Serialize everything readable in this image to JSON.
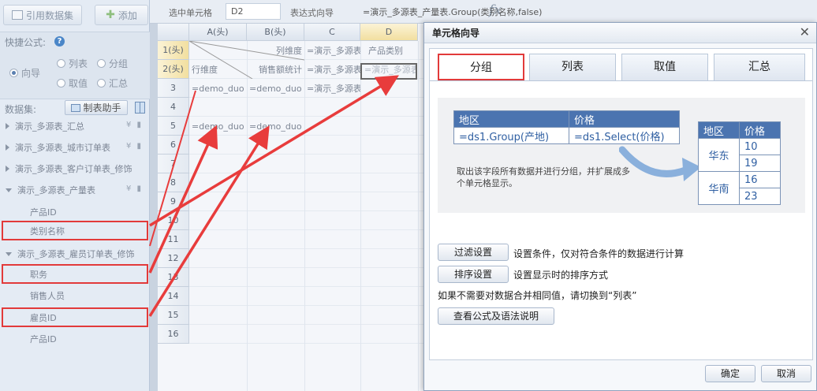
{
  "toolbar": {
    "ref_dataset": "引用数据集",
    "add": "添加"
  },
  "quick_formula": {
    "label": "快捷公式:",
    "options": {
      "guide": "向导",
      "list": "列表",
      "group": "分组",
      "value": "取值",
      "sum": "汇总"
    },
    "selected": "guide"
  },
  "dataset": {
    "label": "数据集:",
    "assist_button": "制表助手",
    "tree": [
      {
        "label": "演示_多源表_汇总",
        "expanded": false
      },
      {
        "label": "演示_多源表_城市订单表",
        "expanded": false
      },
      {
        "label": "演示_多源表_客户订单表_修饰",
        "expanded": false
      },
      {
        "label": "演示_多源表_产量表",
        "expanded": true,
        "fields": [
          "产品ID",
          "类别名称"
        ]
      },
      {
        "label": "演示_多源表_雇员订单表_修饰",
        "expanded": true,
        "fields": [
          "职务",
          "销售人员",
          "雇员ID",
          "产品ID"
        ]
      }
    ]
  },
  "formula_bar": {
    "selected_cell_label": "选中单元格",
    "selected_cell": "D2",
    "expr_guide_label": "表达式向导",
    "expression": "=演示_多源表_产量表.Group(类别名称,false)"
  },
  "grid": {
    "columns": [
      "A(头)",
      "B(头)",
      "C",
      "D"
    ],
    "rows": [
      "1(头)",
      "2(头)",
      "3",
      "4",
      "5",
      "6",
      "7",
      "8",
      "9",
      "10",
      "11",
      "12",
      "13",
      "14",
      "15",
      "16"
    ],
    "cells": {
      "B1": "列维度",
      "C1": "=演示_多源表",
      "D1": "产品类别",
      "A2": "行维度",
      "B2": "销售额统计",
      "C2": "=演示_多源表",
      "D2": "=演示_多源表",
      "A3": "=demo_duo",
      "B3": "=demo_duo",
      "C3": "=演示_多源表",
      "A5": "=demo_duo",
      "B5": "=demo_duo"
    }
  },
  "dialog": {
    "title": "单元格向导",
    "tabs": [
      "分组",
      "列表",
      "取值",
      "汇总"
    ],
    "active_tab": "分组",
    "illustration": {
      "left_table": {
        "headers": [
          "地区",
          "价格"
        ],
        "row": [
          "=ds1.Group(产地)",
          "=ds1.Select(价格)"
        ]
      },
      "note": "取出该字段所有数据并进行分组，并扩展成多个单元格显示。",
      "right_table": {
        "headers": [
          "地区",
          "价格"
        ],
        "groups": [
          {
            "region": "华东",
            "values": [
              "10",
              "19"
            ]
          },
          {
            "region": "华南",
            "values": [
              "16",
              "23"
            ]
          }
        ]
      }
    },
    "filter_button": "过滤设置",
    "filter_desc": "设置条件，仅对符合条件的数据进行计算",
    "sort_button": "排序设置",
    "sort_desc": "设置显示时的排序方式",
    "switch_note": "如果不需要对数据合并相同值，请切换到“列表”",
    "syntax_button": "查看公式及语法说明",
    "ok": "确定",
    "cancel": "取消"
  },
  "colors": {
    "highlight": "#e23a3a",
    "table_header": "#4b74b0",
    "arrow": "#8ab0dc"
  }
}
